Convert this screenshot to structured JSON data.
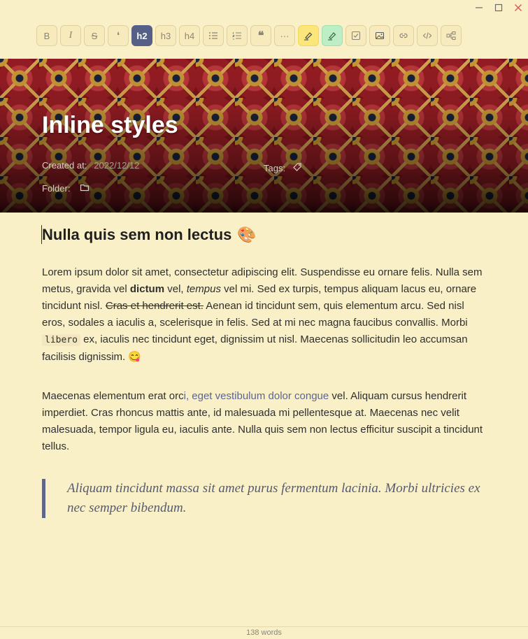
{
  "window": {
    "minimize_icon": "minimize-icon",
    "maximize_icon": "maximize-icon",
    "close_icon": "close-icon",
    "close_color": "#d9534f"
  },
  "toolbar": {
    "items": [
      {
        "id": "bold",
        "label": "B"
      },
      {
        "id": "italic",
        "label": "I"
      },
      {
        "id": "strike",
        "label": "S"
      },
      {
        "id": "highlight-mark",
        "label": "❛"
      },
      {
        "id": "h2",
        "label": "h2",
        "active": true
      },
      {
        "id": "h3",
        "label": "h3"
      },
      {
        "id": "h4",
        "label": "h4"
      },
      {
        "id": "bullet-list",
        "icon": "bullet-list-icon"
      },
      {
        "id": "ordered-list",
        "icon": "ordered-list-icon"
      },
      {
        "id": "blockquote",
        "label": "❝"
      },
      {
        "id": "divider",
        "label": "···"
      },
      {
        "id": "highlight-yellow",
        "icon": "highlighter-icon",
        "color": "#fbe67c"
      },
      {
        "id": "highlight-green",
        "icon": "highlighter-icon",
        "color": "#bdeec6"
      },
      {
        "id": "task-list",
        "icon": "checkbox-icon"
      },
      {
        "id": "image",
        "icon": "image-icon"
      },
      {
        "id": "link",
        "icon": "link-icon"
      },
      {
        "id": "code",
        "icon": "code-icon"
      },
      {
        "id": "diagram",
        "icon": "diagram-icon"
      }
    ],
    "active_color": "#565f85"
  },
  "banner": {
    "title": "Inline styles",
    "created_label": "Created at:",
    "created_value": "2022/12/12",
    "tags_label": "Tags:",
    "folder_label": "Folder:"
  },
  "content": {
    "heading": "Nulla quis sem non lectus",
    "heading_emoji": "🎨",
    "p1": {
      "t1": "Lorem ipsum dolor sit amet, consectetur adipiscing elit. Suspendisse eu ornare felis. Nulla sem metus, gravida vel ",
      "bold": "dictum",
      "t2": " vel, ",
      "italic": "tempus",
      "t3": " vel mi. Sed ex turpis, tempus aliquam lacus eu, ornare tincidunt nisl. ",
      "strike": "Cras et hendrerit est.",
      "t4": " Aenean id tincidunt sem, quis elementum arcu. Sed nisl eros, sodales a iaculis a, scelerisque in felis. Sed at mi nec magna faucibus convallis. Morbi ",
      "code": "libero",
      "t5": " ex, iaculis nec tincidunt eget, dignissim ut nisl. Maecenas sollicitudin leo accumsan facilisis dignissim. ",
      "emoji": "😋"
    },
    "p2": {
      "t1": "Maecenas elementum erat orc",
      "link": "i, eget vestibulum dolor congue",
      "t2": " vel. Aliquam cursus hendrerit imperdiet. Cras rhoncus mattis ante, id malesuada mi pellentesque at. Maecenas nec velit malesuada, tempor ligula eu, iaculis ante. Nulla quis sem non lectus efficitur suscipit a tincidunt tellus."
    },
    "quote": "Aliquam tincidunt massa sit amet purus fermentum lacinia. Morbi ultricies ex nec semper bibendum."
  },
  "footer": {
    "word_count": "138 words"
  }
}
